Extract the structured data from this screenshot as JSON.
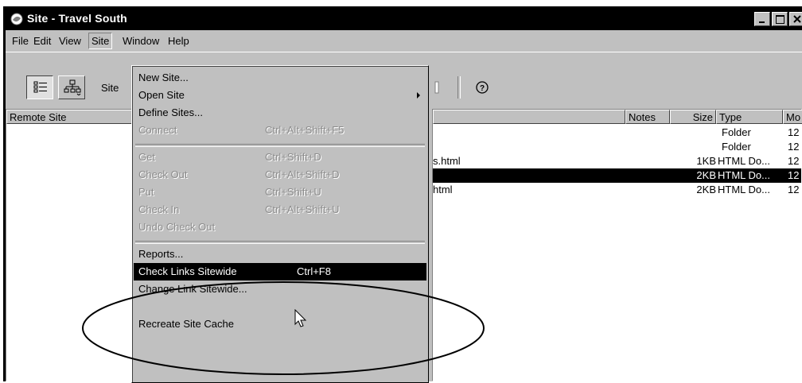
{
  "window": {
    "title": "Site - Travel South",
    "controls": [
      "minimize-icon",
      "maximize-icon",
      "close-icon"
    ]
  },
  "menubar": {
    "items": [
      {
        "label": "File",
        "active": false
      },
      {
        "label": "Edit",
        "active": false
      },
      {
        "label": "View",
        "active": false
      },
      {
        "label": "Site",
        "active": true
      },
      {
        "label": "Window",
        "active": false
      },
      {
        "label": "Help",
        "active": false
      }
    ]
  },
  "toolbar": {
    "site_label": "Site"
  },
  "remote_pane": {
    "header": "Remote Site"
  },
  "local_pane": {
    "columns": [
      "Notes",
      "Size",
      "Type",
      "Mo"
    ],
    "rows": [
      {
        "name": "",
        "size": "",
        "type": "Folder",
        "mod": "12",
        "selected": false
      },
      {
        "name": "",
        "size": "",
        "type": "Folder",
        "mod": "12",
        "selected": false
      },
      {
        "name": "s.html",
        "size": "1KB",
        "type": "HTML Do...",
        "mod": "12",
        "selected": false
      },
      {
        "name": "",
        "size": "2KB",
        "type": "HTML Do...",
        "mod": "12",
        "selected": true
      },
      {
        "name": "html",
        "size": "2KB",
        "type": "HTML Do...",
        "mod": "12",
        "selected": false
      }
    ]
  },
  "site_menu": {
    "items": [
      {
        "label": "New Site...",
        "shortcut": "",
        "disabled": false,
        "submenu": false
      },
      {
        "label": "Open Site",
        "shortcut": "",
        "disabled": false,
        "submenu": true
      },
      {
        "label": "Define Sites...",
        "shortcut": "",
        "disabled": false,
        "submenu": false
      },
      {
        "label": "Connect",
        "shortcut": "Ctrl+Alt+Shift+F5",
        "disabled": true,
        "submenu": false
      },
      {
        "label": "Get",
        "shortcut": "Ctrl+Shift+D",
        "disabled": true,
        "submenu": false
      },
      {
        "label": "Check Out",
        "shortcut": "Ctrl+Alt+Shift+D",
        "disabled": true,
        "submenu": false
      },
      {
        "label": "Put",
        "shortcut": "Ctrl+Shift+U",
        "disabled": true,
        "submenu": false
      },
      {
        "label": "Check In",
        "shortcut": "Ctrl+Alt+Shift+U",
        "disabled": true,
        "submenu": false
      },
      {
        "label": "Undo Check Out",
        "shortcut": "",
        "disabled": true,
        "submenu": false
      },
      {
        "label": "Reports...",
        "shortcut": "",
        "disabled": false,
        "submenu": false
      },
      {
        "label": "Check Links Sitewide",
        "shortcut": "Ctrl+F8",
        "disabled": false,
        "submenu": false,
        "highlighted": true
      },
      {
        "label": "Change Link Sitewide...",
        "shortcut": "",
        "disabled": false,
        "submenu": false
      },
      {
        "label": "Recreate Site Cache",
        "shortcut": "",
        "disabled": false,
        "submenu": false
      }
    ]
  },
  "annotation": {
    "highlight_color": "#000000"
  }
}
